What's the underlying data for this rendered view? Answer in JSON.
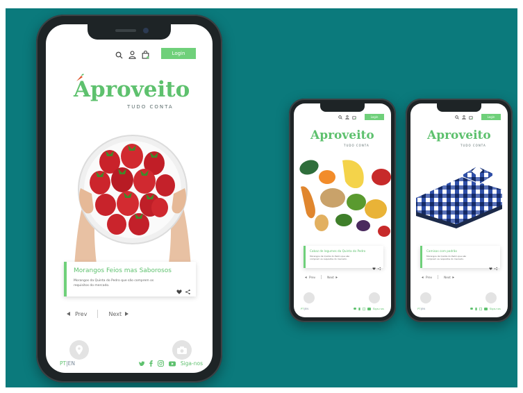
{
  "colors": {
    "background": "#0b7a7c",
    "brand_green": "#5ec16e",
    "login_green": "#6fd07a",
    "phone_frame": "#1e2426"
  },
  "icons": {
    "search": "search-icon",
    "user": "user-icon",
    "bag": "shopping-bag-icon",
    "heart": "heart-icon",
    "share": "share-icon",
    "location": "location-icon",
    "camera": "camera-icon",
    "twitter": "twitter-icon",
    "facebook": "facebook-icon",
    "instagram": "instagram-icon",
    "youtube": "youtube-icon"
  },
  "brand": {
    "logo": "Aproveito",
    "tagline": "TUDO CONTA"
  },
  "header": {
    "login_label": "Login"
  },
  "phones": [
    {
      "card_title": "Morangos Feios mas Saborosos",
      "card_description": "Morangos da Quinta do Pedro que são comprem os requisitos do mercado.",
      "nav_prev": "Prev",
      "nav_next": "Next",
      "lang_pt": "PT",
      "lang_sep": "|",
      "lang_en": "EN",
      "follow_label": "Siga-nos"
    },
    {
      "card_title": "Cabaz de legumes da Quinta do Pedro",
      "card_description": "Morangos da Quinta do Pedro que são comprem os requisitos do mercado.",
      "nav_prev": "Prev",
      "nav_next": "Next",
      "lang_pt": "PT",
      "lang_sep": "|",
      "lang_en": "EN",
      "follow_label": "Siga-nos"
    },
    {
      "card_title": "Camisas com padrão",
      "card_description": "Morangos da Quinta do Pedro que são comprem os requisitos do mercado.",
      "nav_prev": "Prev",
      "nav_next": "Next",
      "lang_pt": "PT",
      "lang_sep": "|",
      "lang_en": "EN",
      "follow_label": "Siga-nos"
    }
  ]
}
